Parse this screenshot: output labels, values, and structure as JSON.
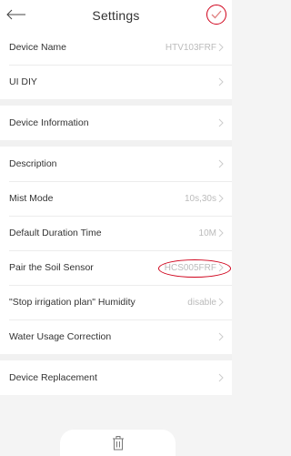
{
  "header": {
    "title": "Settings"
  },
  "rows": {
    "device_name": {
      "label": "Device Name",
      "value": "HTV103FRF"
    },
    "ui_diy": {
      "label": "UI DIY"
    },
    "device_information": {
      "label": "Device Information"
    },
    "description": {
      "label": "Description"
    },
    "mist_mode": {
      "label": "Mist Mode",
      "value": "10s,30s"
    },
    "default_duration": {
      "label": "Default Duration Time",
      "value": "10M"
    },
    "pair_soil_sensor": {
      "label": "Pair the Soil Sensor",
      "value": "HCS005FRF"
    },
    "stop_irrigation": {
      "label": "\"Stop irrigation plan\" Humidity",
      "value": "disable"
    },
    "water_usage": {
      "label": "Water Usage Correction"
    },
    "device_replacement": {
      "label": "Device Replacement"
    }
  },
  "icons": {
    "back": "back-arrow-icon",
    "confirm": "check-icon",
    "chevron": "chevron-right-icon",
    "delete": "trash-icon"
  },
  "colors": {
    "highlight": "#d0021b",
    "value_text": "#bbbbbb",
    "background": "#f4f4f4"
  }
}
